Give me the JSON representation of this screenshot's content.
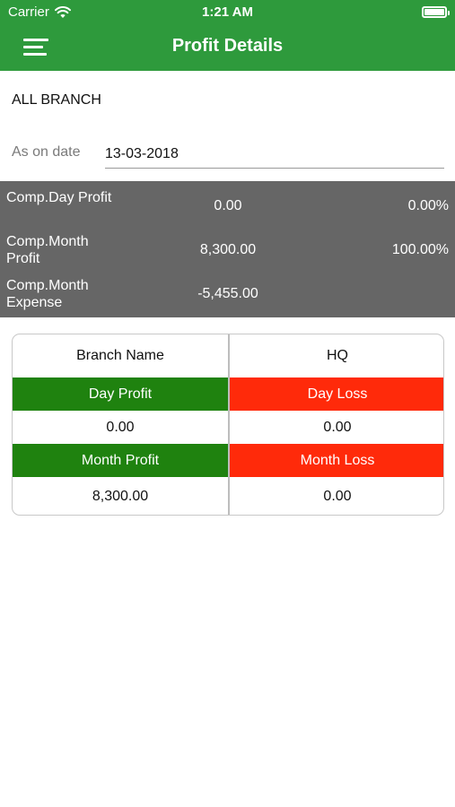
{
  "status_bar": {
    "carrier": "Carrier",
    "time": "1:21 AM"
  },
  "nav": {
    "title": "Profit Details",
    "menu_icon": "hamburger-menu-icon"
  },
  "branch": {
    "label": "ALL BRANCH"
  },
  "date": {
    "label": "As on date",
    "value": "13-03-2018"
  },
  "summary": [
    {
      "label": "Comp.Day Profit",
      "value": "0.00",
      "percent": "0.00%"
    },
    {
      "label": "Comp.Month Profit",
      "value": "8,300.00",
      "percent": "100.00%"
    },
    {
      "label": "Comp.Month Expense",
      "value": "-5,455.00",
      "percent": ""
    }
  ],
  "table": {
    "header_left": "Branch Name",
    "header_right": "HQ",
    "day_profit_label": "Day Profit",
    "day_loss_label": "Day Loss",
    "day_profit_value": "0.00",
    "day_loss_value": "0.00",
    "month_profit_label": "Month Profit",
    "month_loss_label": "Month Loss",
    "month_profit_value": "8,300.00",
    "month_loss_value": "0.00"
  },
  "colors": {
    "header_green": "#2e9a3c",
    "profit_green": "#1f820f",
    "loss_red": "#ff2a0a",
    "summary_gray": "#666666"
  }
}
